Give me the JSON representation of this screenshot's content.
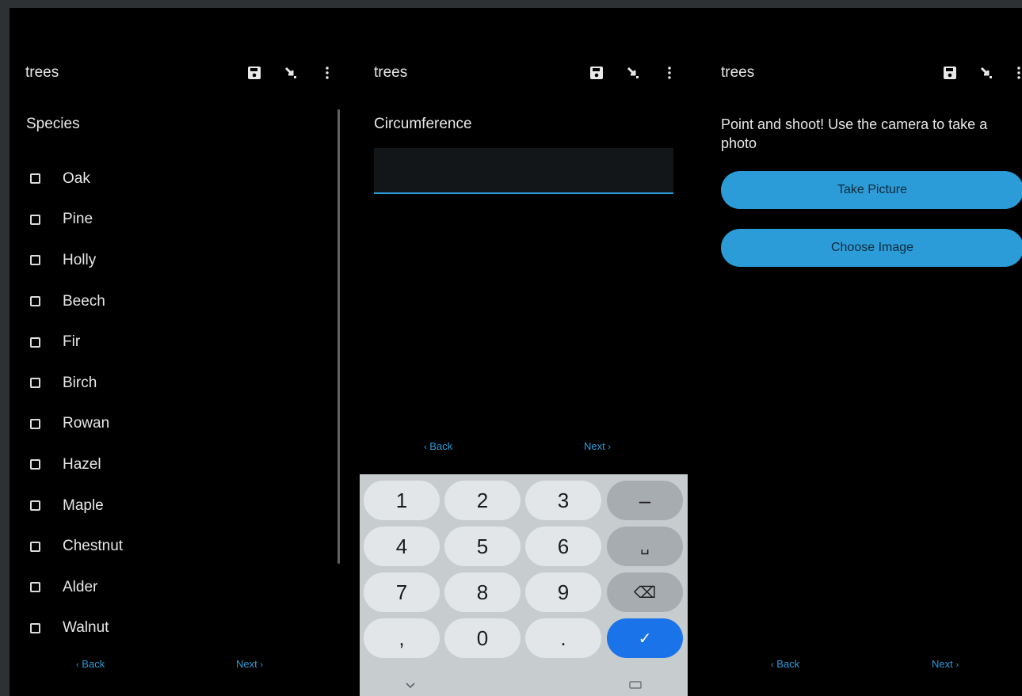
{
  "panels": [
    {
      "app_title": "trees",
      "question": "Species",
      "options": [
        "Oak",
        "Pine",
        "Holly",
        "Beech",
        "Fir",
        "Birch",
        "Rowan",
        "Hazel",
        "Maple",
        "Chestnut",
        "Alder",
        "Walnut"
      ],
      "nav": {
        "back": "Back",
        "next": "Next"
      }
    },
    {
      "app_title": "trees",
      "question": "Circumference",
      "input_value": "",
      "nav": {
        "back": "Back",
        "next": "Next"
      }
    },
    {
      "app_title": "trees",
      "question": "Point and shoot! Use the camera to take a photo",
      "buttons": {
        "take_picture": "Take Picture",
        "choose_image": "Choose Image"
      },
      "nav": {
        "back": "Back",
        "next": "Next"
      }
    }
  ],
  "keyboard": {
    "keys": [
      "1",
      "2",
      "3",
      "–",
      "4",
      "5",
      "6",
      "␣",
      "7",
      "8",
      "9",
      "⌫",
      ",",
      "0",
      ".",
      "✓"
    ]
  },
  "colors": {
    "accent": "#2b9cd8",
    "background": "#000000",
    "enter_key": "#1a73e8"
  }
}
